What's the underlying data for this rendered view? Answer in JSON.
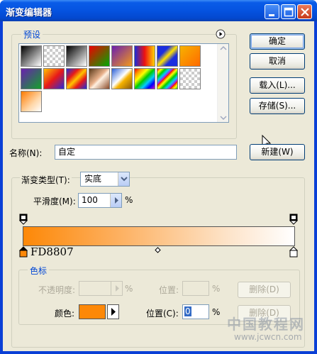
{
  "window": {
    "title": "渐变编辑器"
  },
  "presets": {
    "label": "预设",
    "menu_icon": "circle-arrow-right-icon",
    "swatches": [
      {
        "bg": "linear-gradient(135deg,#000 0%,#fff 100%)"
      },
      {
        "bg": "checker-fade"
      },
      {
        "bg": "linear-gradient(135deg,#000 0%,#fff 100%)"
      },
      {
        "bg": "linear-gradient(135deg,#e00 0%,#0a0 100%)"
      },
      {
        "bg": "linear-gradient(135deg,#6a1fb0 0%,#f39a1a 100%)"
      },
      {
        "bg": "linear-gradient(90deg,#1a2bd8 0%,#e11 50%,#ffd200 100%)"
      },
      {
        "bg": "linear-gradient(135deg,#1b2ee0 30%,#ffe200 50%,#1b2ee0 70%)"
      },
      {
        "bg": "linear-gradient(135deg,#f7b200 0%,#ff6a00 100%)"
      },
      {
        "bg": "linear-gradient(135deg,#6a1fb0 0%,#12a22a 100%)"
      },
      {
        "bg": "linear-gradient(135deg,#ffc400 0%,#e81919 50%,#2a2ad8 100%)"
      },
      {
        "bg": "linear-gradient(135deg,#1b2ee0 0%,#e81919 30%,#ffc400 50%,#e81919 70%,#1b2ee0 100%)"
      },
      {
        "bg": "linear-gradient(135deg,#5a3a1a 0%,#e8b08a 45%,#fff0e0 55%,#8a4a28 100%)"
      },
      {
        "bg": "linear-gradient(135deg,#2a5fd8 0%,#fff 45%,#f5b200 60%,#8a5a10 100%)"
      },
      {
        "bg": "linear-gradient(135deg,#e00 0%,#f90 17%,#ff0 33%,#0c0 50%,#0cf 67%,#00f 83%,#c0c 100%)"
      },
      {
        "bg": "repeating-linear-gradient(135deg,#e00 0,#ff0 4px,#0c0 8px,#0cf 12px,#c0c 16px)"
      },
      {
        "bg": "checker-fade"
      },
      {
        "bg": "linear-gradient(135deg,#ff7a00 0%,#ffd7a8 60%,#fff 100%)"
      }
    ]
  },
  "buttons": {
    "ok": "确定",
    "cancel": "取消",
    "load": "载入(L)...",
    "save": "存储(S)...",
    "new": "新建(W)"
  },
  "name_row": {
    "label": "名称(N):",
    "value": "自定"
  },
  "gradient_type": {
    "label": "渐变类型(T):",
    "value": "实底"
  },
  "smoothness": {
    "label": "平滑度(M):",
    "value": "100",
    "unit": "%"
  },
  "gradient": {
    "start_color": "#FD8807",
    "end_color": "#FFFFFF",
    "stop_annotation": "FD8807"
  },
  "color_stops": {
    "label": "色标",
    "opacity_label": "不透明度:",
    "opacity_unit": "%",
    "opacity_location_label": "位置:",
    "opacity_location_unit": "%",
    "opacity_delete": "删除(D)",
    "color_label": "颜色:",
    "color_value": "#FD8807",
    "color_location_label": "位置(C):",
    "color_location_value": "0",
    "color_location_unit": "%",
    "color_delete": "删除(D)"
  },
  "watermark": {
    "line1": "中国教程网",
    "line2": "www.jcwcn.com"
  }
}
